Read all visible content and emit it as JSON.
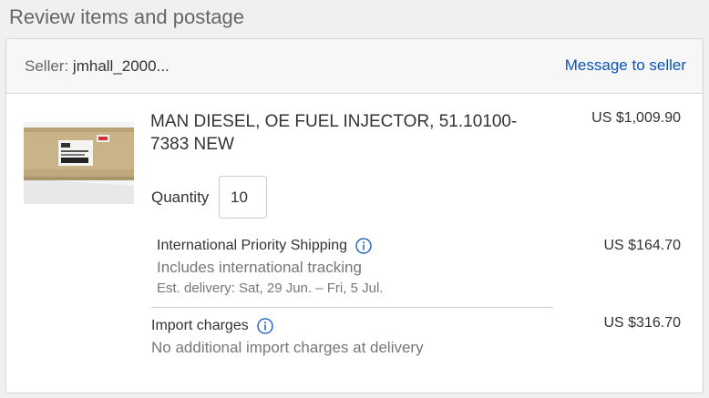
{
  "section_title": "Review items and postage",
  "seller": {
    "label": "Seller:",
    "name": "jmhall_2000..."
  },
  "message_link": "Message to seller",
  "item": {
    "title": "MAN DIESEL, OE FUEL INJECTOR, 51.10100-7383 NEW",
    "price": "US $1,009.90",
    "quantity_label": "Quantity",
    "quantity_value": "10",
    "image_icon": "product-photo-box"
  },
  "shipping": {
    "name": "International Priority Shipping",
    "subtitle": "Includes international tracking",
    "estimate": "Est. delivery: Sat, 29 Jun. – Fri, 5 Jul.",
    "price": "US $164.70",
    "icon": "info-icon"
  },
  "import": {
    "name": "Import charges",
    "subtitle": "No additional import charges at delivery",
    "price": "US $316.70",
    "icon": "info-icon"
  },
  "colors": {
    "link": "#0654ba",
    "info_icon": "#0654ba"
  }
}
